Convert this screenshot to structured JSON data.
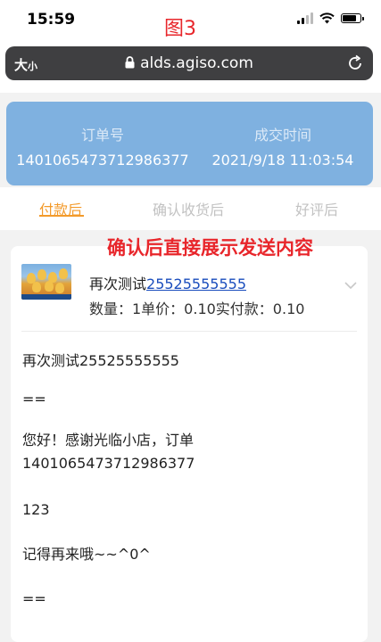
{
  "status_bar": {
    "time": "15:59",
    "figure_label": "图3"
  },
  "browser": {
    "text_size": "大",
    "text_size_small": "小",
    "url": "alds.agiso.com"
  },
  "order_summary": {
    "order_label": "订单号",
    "order_number": "1401065473712986377",
    "deal_time_label": "成交时间",
    "deal_time": "2021/9/18 11:03:54"
  },
  "tabs": [
    {
      "label": "付款后",
      "active": true
    },
    {
      "label": "确认收货后",
      "active": false
    },
    {
      "label": "好评后",
      "active": false
    }
  ],
  "annotation": "确认后直接展示发送内容",
  "product": {
    "title_prefix": "再次测试",
    "title_link": "25525555555",
    "meta": "数量：1单价：0.10实付款：0.10"
  },
  "message_lines": [
    "再次测试25525555555",
    "==",
    "您好！感谢光临小店，订单",
    "1401065473712986377",
    "123",
    "记得再来哦~~^0^",
    "=="
  ],
  "colors": {
    "accent": "#f39a2a",
    "summary_bg": "#7fb1e0",
    "annotation_red": "#e8262b",
    "link": "#1a4dbd"
  }
}
